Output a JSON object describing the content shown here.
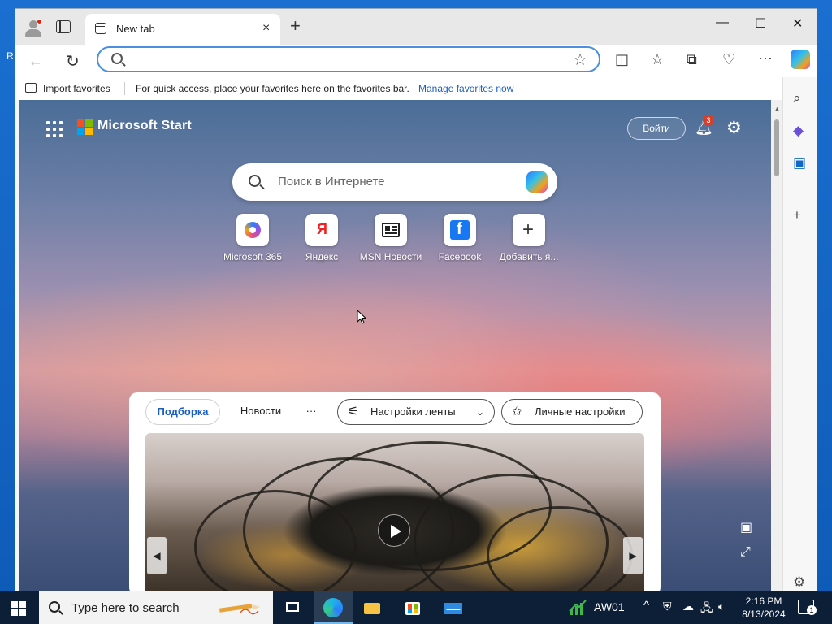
{
  "browser": {
    "tab_title": "New tab",
    "tab_close": "×",
    "new_tab": "+",
    "window_controls": {
      "minimize": "—",
      "maximize": "☐",
      "close": "✕"
    },
    "address_value": "",
    "toolbar_icons": [
      "split-screen",
      "favorites",
      "collections",
      "browser-essentials",
      "more"
    ],
    "more_label": "···"
  },
  "favorites_bar": {
    "import_label": "Import favorites",
    "hint": "For quick access, place your favorites here on the favorites bar.",
    "link": "Manage favorites now"
  },
  "page": {
    "brand": "Microsoft Start",
    "signin": "Войти",
    "notifications_count": "3",
    "search_placeholder": "Поиск в Интернете",
    "quick_links": [
      {
        "label": "Microsoft 365",
        "icon": "microsoft-365"
      },
      {
        "label": "Яндекс",
        "icon": "yandex"
      },
      {
        "label": "MSN Новости",
        "icon": "msn-news"
      },
      {
        "label": "Facebook",
        "icon": "facebook"
      },
      {
        "label": "Добавить я...",
        "icon": "plus"
      }
    ],
    "feed": {
      "tab_selected": "Подборка",
      "tab_news": "Новости",
      "more": "···",
      "feed_settings": "Настройки ленты",
      "personal_settings": "Личные настройки"
    }
  },
  "taskbar": {
    "search_placeholder": "Type here to search",
    "tray_label": "AW01",
    "time": "2:16 PM",
    "date": "8/13/2024",
    "notification_count": "1"
  },
  "colors": {
    "accent": "#1a5fc0",
    "badge": "#d6402b",
    "taskbar": "#0d1f36"
  }
}
